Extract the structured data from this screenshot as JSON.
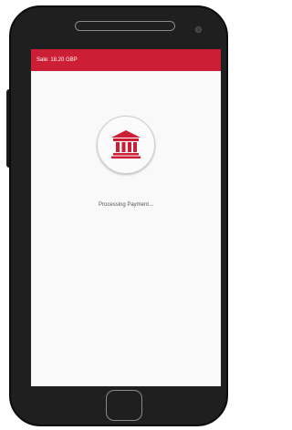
{
  "header": {
    "sale_label": "Sale: 18.20 GBP"
  },
  "status": {
    "message": "Processing Payment..."
  },
  "icons": {
    "payment_icon": "bank-icon"
  },
  "colors": {
    "accent": "#cc1f36",
    "screen_background": "#f9f9f9",
    "phone_body": "#1f1f1f"
  }
}
